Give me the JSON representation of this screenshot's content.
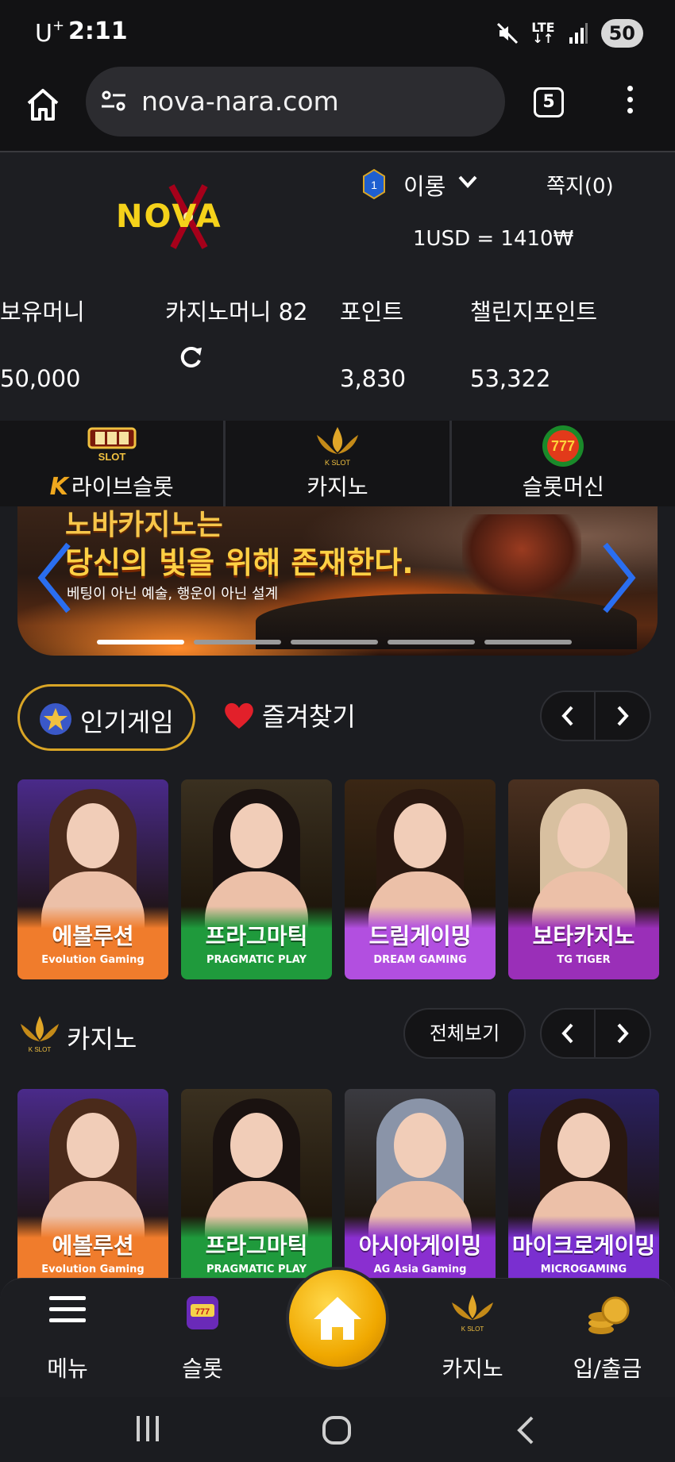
{
  "status_bar": {
    "carrier": "U",
    "carrier_sup": "+",
    "time": "2:11",
    "network": "LTE",
    "battery": "50"
  },
  "browser": {
    "url": "nova-nara.com",
    "tab_count": "5"
  },
  "header": {
    "logo_text": "NOVA",
    "level": "1",
    "username": "이롱",
    "messages": "쪽지(0)",
    "exchange_rate": "1USD = 1410₩"
  },
  "balances": [
    {
      "label": "보유머니",
      "value": "50,000"
    },
    {
      "label": "카지노머니 82",
      "value": ""
    },
    {
      "label": "포인트",
      "value": "3,830"
    },
    {
      "label": "챌린지포인트",
      "value": "53,322"
    }
  ],
  "categories": [
    {
      "label": "라이브슬롯",
      "icon": "live-slot-icon",
      "prefix": "K"
    },
    {
      "label": "카지노",
      "icon": "k-slot-icon"
    },
    {
      "label": "슬롯머신",
      "icon": "777-slots-icon"
    }
  ],
  "banner": {
    "line1": "노바카지노는",
    "line2": "당신의 빛을 위해 존재한다.",
    "subtitle": "베팅이 아닌 예술, 행운이 아닌 설계",
    "slide_count": 5,
    "active_slide": 1
  },
  "tabs": {
    "popular": "인기게임",
    "favorites": "즐겨찾기"
  },
  "popular_games": [
    {
      "title": "에볼루션",
      "brand": "Evolution Gaming",
      "color": "#f07c2c",
      "bg": "#4a2a8a",
      "hair": "#4a2a1a"
    },
    {
      "title": "프라그마틱",
      "brand": "PRAGMATIC PLAY",
      "color": "#1f9a3c",
      "bg": "#3a3020",
      "hair": "#1a1210"
    },
    {
      "title": "드림게이밍",
      "brand": "DREAM GAMING",
      "color": "#b24fe0",
      "bg": "#3a2614",
      "hair": "#2a1810"
    },
    {
      "title": "보타카지노",
      "brand": "TG TIGER",
      "color": "#9a2fb8",
      "bg": "#4a3020",
      "hair": "#d8c0a0"
    }
  ],
  "casino_section": {
    "title": "카지노",
    "view_all": "전체보기"
  },
  "casino_games": [
    {
      "title": "에볼루션",
      "brand": "Evolution Gaming",
      "color": "#f07c2c",
      "bg": "#4a2a8a",
      "hair": "#4a2a1a"
    },
    {
      "title": "프라그마틱",
      "brand": "PRAGMATIC PLAY",
      "color": "#1f9a3c",
      "bg": "#3a3020",
      "hair": "#1a1210"
    },
    {
      "title": "아시아게이밍",
      "brand": "AG Asia Gaming",
      "color": "#8a2fd0",
      "bg": "#3a3a40",
      "hair": "#8a94a8"
    },
    {
      "title": "마이크로게이밍",
      "brand": "MICROGAMING",
      "color": "#7a2fd0",
      "bg": "#2a2060",
      "hair": "#2a1810"
    }
  ],
  "bottom_nav": [
    {
      "label": "메뉴",
      "icon": "hamburger-icon"
    },
    {
      "label": "슬롯",
      "icon": "slot-machine-icon"
    },
    {
      "label": "",
      "icon": "home-icon"
    },
    {
      "label": "카지노",
      "icon": "k-slot-icon"
    },
    {
      "label": "입/출금",
      "icon": "coins-icon"
    }
  ],
  "colors": {
    "accent": "#d9a526",
    "background": "#1b1c20",
    "logo_yellow": "#f5d21a"
  }
}
